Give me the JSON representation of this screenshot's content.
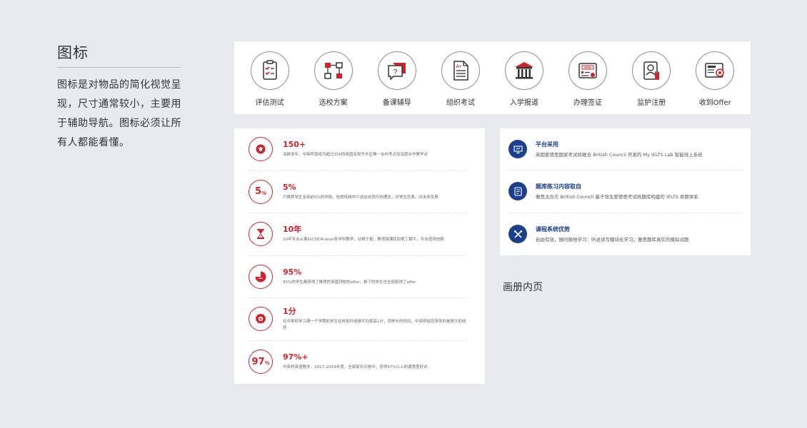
{
  "left": {
    "title": "图标",
    "description": "图标是对物品的简化视觉呈现，尺寸通常较小，主要用于辅助导航。图标必须让所有人都能看懂。"
  },
  "icons": [
    {
      "label": "评估测试",
      "icon": "clipboard-checklist-icon"
    },
    {
      "label": "选校方案",
      "icon": "flowchart-icon"
    },
    {
      "label": "备课辅导",
      "icon": "question-chat-icon"
    },
    {
      "label": "组织考试",
      "icon": "exam-paper-icon"
    },
    {
      "label": "入学报道",
      "icon": "university-building-icon"
    },
    {
      "label": "办理签证",
      "icon": "visa-card-icon"
    },
    {
      "label": "监护注册",
      "icon": "guardian-id-icon"
    },
    {
      "label": "收到Offer",
      "icon": "offer-letter-icon"
    }
  ],
  "stats": [
    {
      "value": "150+",
      "desc": "深耕多年，中英桥现成为超过150所英国名校华东区唯一合作考点及深度合作教学点",
      "icon": "school-badge-icon"
    },
    {
      "value": "5%",
      "desc": "只推荐学生全英前5%的学校，杜绝传统中介送出去就行的理念，对学生负责，对未来负责",
      "icon": "percent-badge",
      "badge_main": "5",
      "badge_sub": "%"
    },
    {
      "value": "10年",
      "desc": "10年专业从事IGCSE/A-level各学科教学，业精于勤，教师授课犹如庖丁解牛，专业值得信赖",
      "icon": "hourglass-icon"
    },
    {
      "value": "95%",
      "desc": "95%的学生都获得了推荐的英国顶校的offer，剩下的学生也全部获得了offer",
      "icon": "pie-chart-icon",
      "pie_label": "95%"
    },
    {
      "value": "1分",
      "desc": "在中英桥学习满一个学期的学生在校各科成绩平均提高1分，同样长的时间，中英桥给您带来的是更大的收获",
      "icon": "award-medal-icon"
    },
    {
      "value": "97%+",
      "desc": "中英桥英语教学，2017–2019年度，全部家长问卷中，获得97%以上的满意度好评。",
      "icon": "percent-badge",
      "badge_main": "97",
      "badge_sub": "%"
    }
  ],
  "features": [
    {
      "title": "平台采用",
      "desc": "英国爱德思国家考试局联合 British Council 开发的 My IELTS Lab 智能线上系统",
      "icon": "computer-platform-icon"
    },
    {
      "title": "题库练习内容取自",
      "desc": "雅思主办方 British Council 基于培生爱德思考试局题库构建的 IELTS 命题体系",
      "icon": "question-bank-icon"
    },
    {
      "title": "课程系统优势",
      "desc": "自由有效，随时随地学习：听说读写模块化学习；雅思题库真实的模拟试题",
      "icon": "crossed-tools-icon"
    }
  ],
  "caption": "画册内页",
  "colors": {
    "accent_red": "#d3212b",
    "accent_blue": "#1d3f8f",
    "background": "#e8eaf0"
  }
}
